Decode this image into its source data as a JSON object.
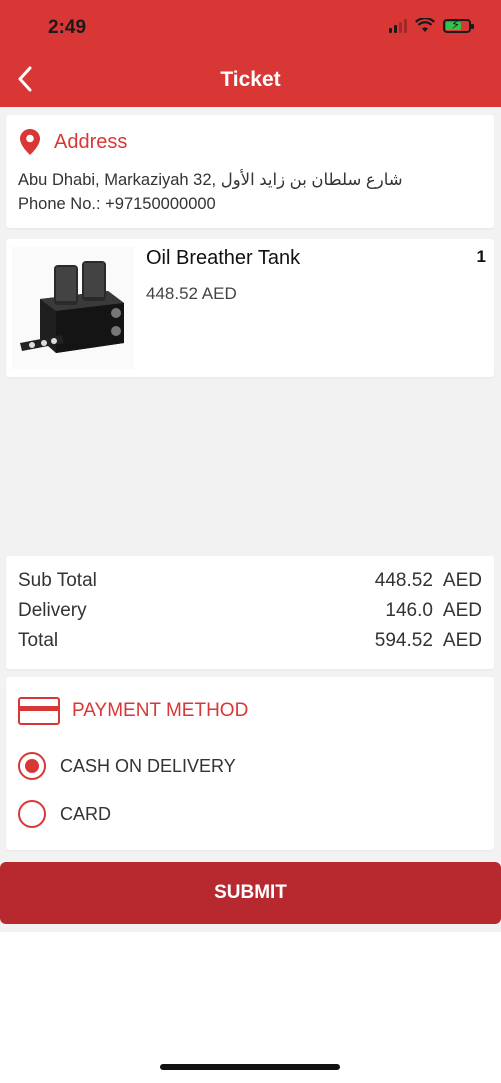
{
  "status_bar": {
    "time": "2:49",
    "icons": [
      "signal-icon",
      "wifi-icon",
      "battery-charging-icon"
    ]
  },
  "header": {
    "title": "Ticket",
    "back_icon": "chevron-left-icon"
  },
  "address": {
    "title": "Address",
    "icon": "location-pin-icon",
    "line": "Abu Dhabi, Markaziyah 32, شارع سلطان بن زايد الأول",
    "phone": "Phone No.: +97150000000"
  },
  "product": {
    "name": "Oil Breather Tank",
    "price": "448.52 AED",
    "quantity": "1"
  },
  "totals": {
    "sub_total_label": "Sub Total",
    "sub_total_value": "448.52",
    "delivery_label": "Delivery",
    "delivery_value": "146.0",
    "total_label": "Total",
    "total_value": "594.52",
    "currency": "AED"
  },
  "payment": {
    "title": "PAYMENT METHOD",
    "options": [
      {
        "label": "CASH ON DELIVERY",
        "selected": true
      },
      {
        "label": "CARD",
        "selected": false
      }
    ]
  },
  "submit_label": "SUBMIT",
  "colors": {
    "brand": "#d93735",
    "button": "#b7292f",
    "background": "#f2f2f2"
  }
}
